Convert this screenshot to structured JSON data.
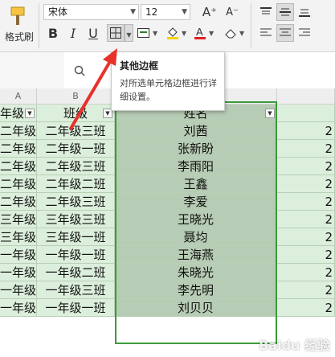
{
  "ribbon": {
    "format_brush_label": "格式刷",
    "font_name": "宋体",
    "font_size": "12",
    "grow_font": "A⁺",
    "shrink_font": "A⁻",
    "bold": "B",
    "italic": "I",
    "underline": "U"
  },
  "tooltip": {
    "title": "其他边框",
    "description": "对所选单元格边框进行详细设置。"
  },
  "sheet": {
    "col_a_header": "A",
    "col_b_header": "B",
    "headers": [
      "年级",
      "班级",
      "姓名"
    ],
    "rows": [
      {
        "grade": "二年级",
        "class": "二年级三班",
        "name": "刘茜"
      },
      {
        "grade": "二年级",
        "class": "二年级一班",
        "name": "张新盼"
      },
      {
        "grade": "二年级",
        "class": "二年级三班",
        "name": "李雨阳"
      },
      {
        "grade": "二年级",
        "class": "二年级二班",
        "name": "王鑫"
      },
      {
        "grade": "二年级",
        "class": "二年级三班",
        "name": "李爱"
      },
      {
        "grade": "三年级",
        "class": "三年级三班",
        "name": "王晓光"
      },
      {
        "grade": "三年级",
        "class": "三年级一班",
        "name": "聂均"
      },
      {
        "grade": "一年级",
        "class": "一年级一班",
        "name": "王海燕"
      },
      {
        "grade": "一年级",
        "class": "一年级二班",
        "name": "朱晓光"
      },
      {
        "grade": "一年级",
        "class": "一年级三班",
        "name": "李先明"
      },
      {
        "grade": "一年级",
        "class": "一年级一班",
        "name": "刘贝贝"
      }
    ],
    "right_col_value": "2"
  },
  "watermark": "Baidu 经验",
  "colors": {
    "cell_fill": "#dcefdc",
    "selected_fill": "#b7ccb4",
    "selection_border": "#3a9b3a",
    "arrow": "#e8312a"
  }
}
